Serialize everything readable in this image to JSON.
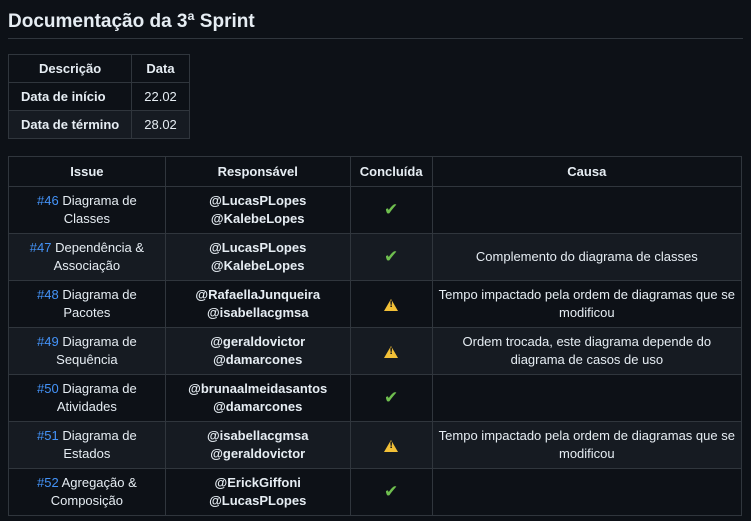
{
  "page": {
    "title": "Documentação da 3ª Sprint"
  },
  "dates_table": {
    "headers": [
      "Descrição",
      "Data"
    ],
    "rows": [
      {
        "label": "Data de início",
        "value": "22.02"
      },
      {
        "label": "Data de término",
        "value": "28.02"
      }
    ]
  },
  "issues_table": {
    "headers": [
      "Issue",
      "Responsável",
      "Concluída",
      "Causa"
    ],
    "rows": [
      {
        "number": "#46",
        "title": "Diagrama de Classes",
        "responsaveis": [
          "@LucasPLopes",
          "@KalebeLopes"
        ],
        "status": "check-icon",
        "status_char": "✔",
        "causa": ""
      },
      {
        "number": "#47",
        "title": "Dependência & Associação",
        "responsaveis": [
          "@LucasPLopes",
          "@KalebeLopes"
        ],
        "status": "check-icon",
        "status_char": "✔",
        "causa": "Complemento do diagrama de classes"
      },
      {
        "number": "#48",
        "title": "Diagrama de Pacotes",
        "responsaveis": [
          "@RafaellaJunqueira",
          "@isabellacgmsa"
        ],
        "status": "warning-icon",
        "status_char": "",
        "causa": "Tempo impactado pela ordem de diagramas que se modificou"
      },
      {
        "number": "#49",
        "title": "Diagrama de Sequência",
        "responsaveis": [
          "@geraldovictor",
          "@damarcones"
        ],
        "status": "warning-icon",
        "status_char": "",
        "causa": "Ordem trocada, este diagrama depende do diagrama de casos de uso"
      },
      {
        "number": "#50",
        "title": "Diagrama de Atividades",
        "responsaveis": [
          "@brunaalmeidasantos",
          "@damarcones"
        ],
        "status": "check-icon",
        "status_char": "✔",
        "causa": ""
      },
      {
        "number": "#51",
        "title": "Diagrama de Estados",
        "responsaveis": [
          "@isabellacgmsa",
          "@geraldovictor"
        ],
        "status": "warning-icon",
        "status_char": "",
        "causa": "Tempo impactado pela ordem de diagramas que se modificou"
      },
      {
        "number": "#52",
        "title": "Agregação & Composição",
        "responsaveis": [
          "@ErickGiffoni",
          "@LucasPLopes"
        ],
        "status": "check-icon",
        "status_char": "✔",
        "causa": ""
      }
    ]
  },
  "colors": {
    "background": "#0d1117",
    "row_alt": "#161b22",
    "border": "#30363d",
    "link": "#4493f8",
    "check": "#6fbf4f",
    "warning": "#f2c037"
  }
}
